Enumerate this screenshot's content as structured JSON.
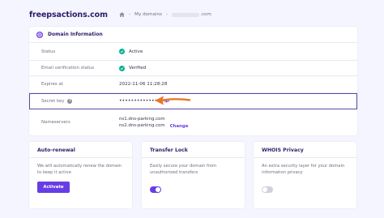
{
  "header": {
    "domain_title": "freepsactions.com",
    "breadcrumb_my_domains": "My domains",
    "breadcrumb_current_suffix": ".com"
  },
  "domain_info": {
    "title": "Domain Information",
    "rows": [
      {
        "label": "Status",
        "value": "Active"
      },
      {
        "label": "Email verification status",
        "value": "Verified"
      },
      {
        "label": "Expires at",
        "value": "2022-11-06 11:28:28"
      },
      {
        "label": "Secret key",
        "value": "••••••••••••••"
      },
      {
        "label": "Nameservers",
        "ns1": "ns1.dns-parking.com",
        "ns2": "ns2.dns-parking.com",
        "action": "Change"
      }
    ]
  },
  "cards": {
    "auto_renewal": {
      "title": "Auto-renewal",
      "desc": "We will automatically renew the domain to keep it active",
      "button": "Activate"
    },
    "transfer_lock": {
      "title": "Transfer Lock",
      "desc": "Easily secure your domain from unauthorized transfers",
      "toggle_on": true
    },
    "whois_privacy": {
      "title": "WHOIS Privacy",
      "desc": "An extra security layer for your domain information privacy",
      "toggle_on": false
    }
  },
  "colors": {
    "accent": "#673de6",
    "success": "#00b090",
    "annotation_arrow": "#e8762b",
    "highlight_border": "#5b4a9e"
  }
}
